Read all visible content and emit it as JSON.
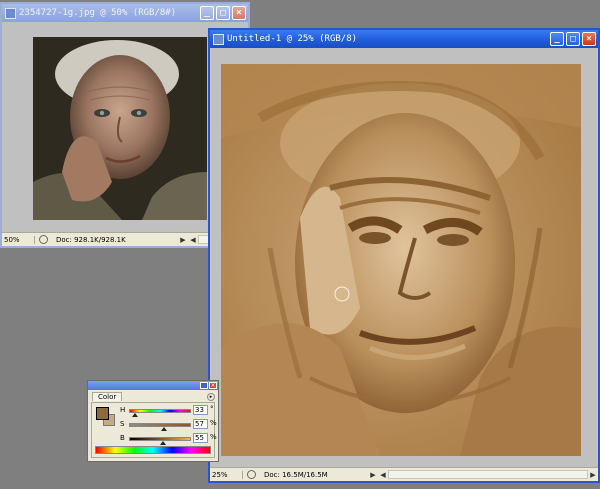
{
  "desktop_bg": "#7f7f7f",
  "reference_window": {
    "title": "2354727-1g.jpg @ 50% (RGB/8#)",
    "zoom": "50%",
    "doc": "Doc: 928.1K/928.1K"
  },
  "canvas_window": {
    "title": "Untitled-1 @ 25% (RGB/8)",
    "zoom": "25%",
    "doc": "Doc: 16.5M/16.5M"
  },
  "window_controls": {
    "minimize": "_",
    "maximize": "□",
    "close": "×"
  },
  "color_palette": {
    "tab": "Color",
    "menu_glyph": "▸",
    "fg_color": "#8c6a3a",
    "bg_color": "#c8aa80",
    "sliders": [
      {
        "label": "H",
        "value": "33",
        "unit": "°",
        "fraction": 0.09
      },
      {
        "label": "S",
        "value": "57",
        "unit": "%",
        "fraction": 0.57
      },
      {
        "label": "B",
        "value": "55",
        "unit": "%",
        "fraction": 0.55
      }
    ]
  },
  "icons": {
    "app": "photoshop-doc-icon",
    "status": "status-info-icon",
    "brush": "brush-cursor-icon"
  }
}
